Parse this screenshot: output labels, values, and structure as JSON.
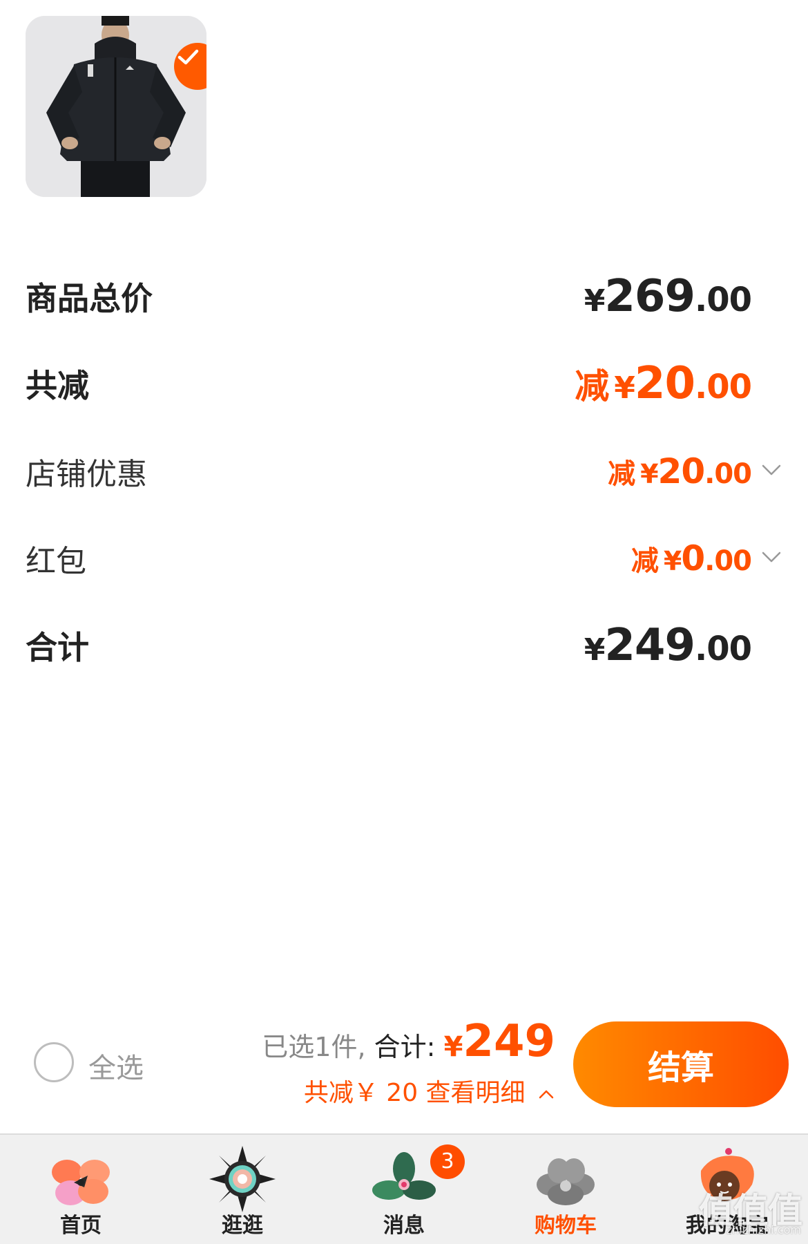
{
  "product": {
    "image_icon": "jacket-product-image",
    "selected": true
  },
  "summary": {
    "goods_total": {
      "label": "商品总价",
      "currency": "¥",
      "int": "269",
      "dec": ".00"
    },
    "total_discount": {
      "label": "共减",
      "prefix": "减",
      "currency": "¥",
      "int": "20",
      "dec": ".00"
    },
    "shop_discount": {
      "label": "店铺优惠",
      "prefix": "减",
      "currency": "¥",
      "int": "20",
      "dec": ".00"
    },
    "red_packet": {
      "label": "红包",
      "prefix": "减",
      "currency": "¥",
      "int": "0",
      "dec": ".00"
    },
    "total": {
      "label": "合计",
      "currency": "¥",
      "int": "249",
      "dec": ".00"
    }
  },
  "checkout_bar": {
    "select_all_label": "全选",
    "selected_text": "已选1件,",
    "total_label": "合计:",
    "total_currency": "¥",
    "total_value": "249",
    "discount_detail": "共减￥ 20  查看明细",
    "checkout_label": "结算"
  },
  "tabs": [
    {
      "label": "首页",
      "icon": "home-flower-icon"
    },
    {
      "label": "逛逛",
      "icon": "explore-flower-icon"
    },
    {
      "label": "消息",
      "icon": "message-flower-icon",
      "badge": "3"
    },
    {
      "label": "购物车",
      "icon": "cart-flower-icon",
      "active": true
    },
    {
      "label": "我的淘宝",
      "icon": "profile-avatar-icon"
    }
  ],
  "watermark": {
    "main": "值值值",
    "sub": "zhizhizhi.com"
  },
  "colors": {
    "accent": "#ff5000",
    "checkout_start": "#ff8a00",
    "checkout_end": "#ff4d00"
  }
}
